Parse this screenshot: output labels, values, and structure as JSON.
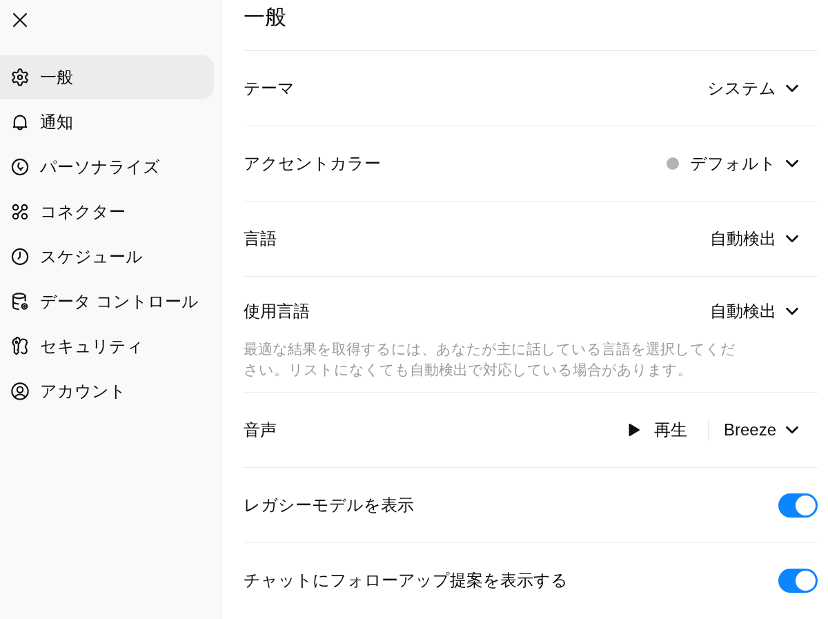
{
  "sidebar": {
    "items": [
      {
        "label": "一般",
        "selected": true
      },
      {
        "label": "通知",
        "selected": false
      },
      {
        "label": "パーソナライズ",
        "selected": false
      },
      {
        "label": "コネクター",
        "selected": false
      },
      {
        "label": "スケジュール",
        "selected": false
      },
      {
        "label": "データ コントロール",
        "selected": false
      },
      {
        "label": "セキュリティ",
        "selected": false
      },
      {
        "label": "アカウント",
        "selected": false
      }
    ]
  },
  "header": {
    "title": "一般"
  },
  "settings": [
    {
      "kind": "select",
      "label": "テーマ",
      "value": "システム"
    },
    {
      "kind": "select",
      "label": "アクセントカラー",
      "value": "デフォルト",
      "color": "#b4b4b4"
    },
    {
      "kind": "select",
      "label": "言語",
      "value": "自動検出"
    },
    {
      "kind": "select",
      "label": "使用言語",
      "value": "自動検出",
      "description": "最適な結果を取得するには、あなたが主に話している言語を選択してください。リストになくても自動検出で対応している場合があります。"
    },
    {
      "kind": "voice",
      "label": "音声",
      "play_label": "再生",
      "value": "Breeze"
    },
    {
      "kind": "toggle",
      "label": "レガシーモデルを表示",
      "on": true
    },
    {
      "kind": "toggle",
      "label": "チャットにフォローアップ提案を表示する",
      "on": true
    }
  ]
}
